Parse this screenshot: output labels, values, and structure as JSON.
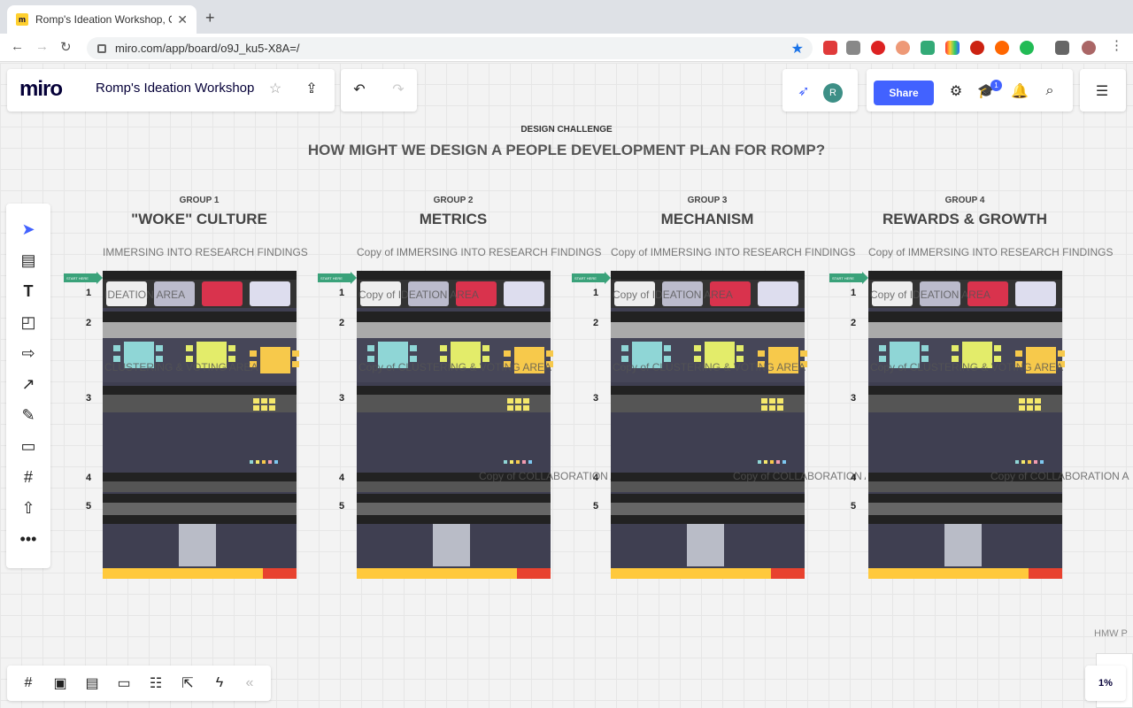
{
  "browser": {
    "tab_title": "Romp's Ideation Workshop, On",
    "url": "miro.com/app/board/o9J_ku5-X8A=/"
  },
  "app": {
    "logo": "miro",
    "board_name": "Romp's Ideation Workshop",
    "share_label": "Share",
    "avatar_initial": "R",
    "notification_count": "1",
    "zoom": "1%"
  },
  "canvas": {
    "challenge_label": "DESIGN CHALLENGE",
    "challenge_title": "HOW MIGHT WE DESIGN A PEOPLE DEVELOPMENT PLAN FOR ROMP?",
    "groups": [
      {
        "label": "GROUP 1",
        "title": "\"WOKE\" CULTURE",
        "copy": "IMMERSING INTO RESEARCH FINDINGS",
        "ideation": "IDEATION AREA",
        "cluster": "CLUSTERING & VOTING AREA",
        "collab": ""
      },
      {
        "label": "GROUP 2",
        "title": "METRICS",
        "copy": "Copy of IMMERSING INTO RESEARCH FINDINGS",
        "ideation": "Copy of IDEATION AREA",
        "cluster": "Copy of CLUSTERING & VOTING AREA",
        "collab": "Copy of COLLABORATION AREA"
      },
      {
        "label": "GROUP 3",
        "title": "MECHANISM",
        "copy": "Copy of IMMERSING INTO RESEARCH FINDINGS",
        "ideation": "Copy of IDEATION AREA",
        "cluster": "Copy of CLUSTERING & VOTING AREA",
        "collab": "Copy of COLLABORATION AREA"
      },
      {
        "label": "GROUP 4",
        "title": "REWARDS & GROWTH",
        "copy": "Copy of IMMERSING INTO RESEARCH FINDINGS",
        "ideation": "Copy of IDEATION AREA",
        "cluster": "Copy of CLUSTERING & VOTING AREA",
        "collab": "Copy of COLLABORATION A"
      }
    ],
    "start_here": "START HERE",
    "row_numbers": [
      "1",
      "2",
      "3",
      "4",
      "5"
    ],
    "hmw_label": "HMW P"
  }
}
